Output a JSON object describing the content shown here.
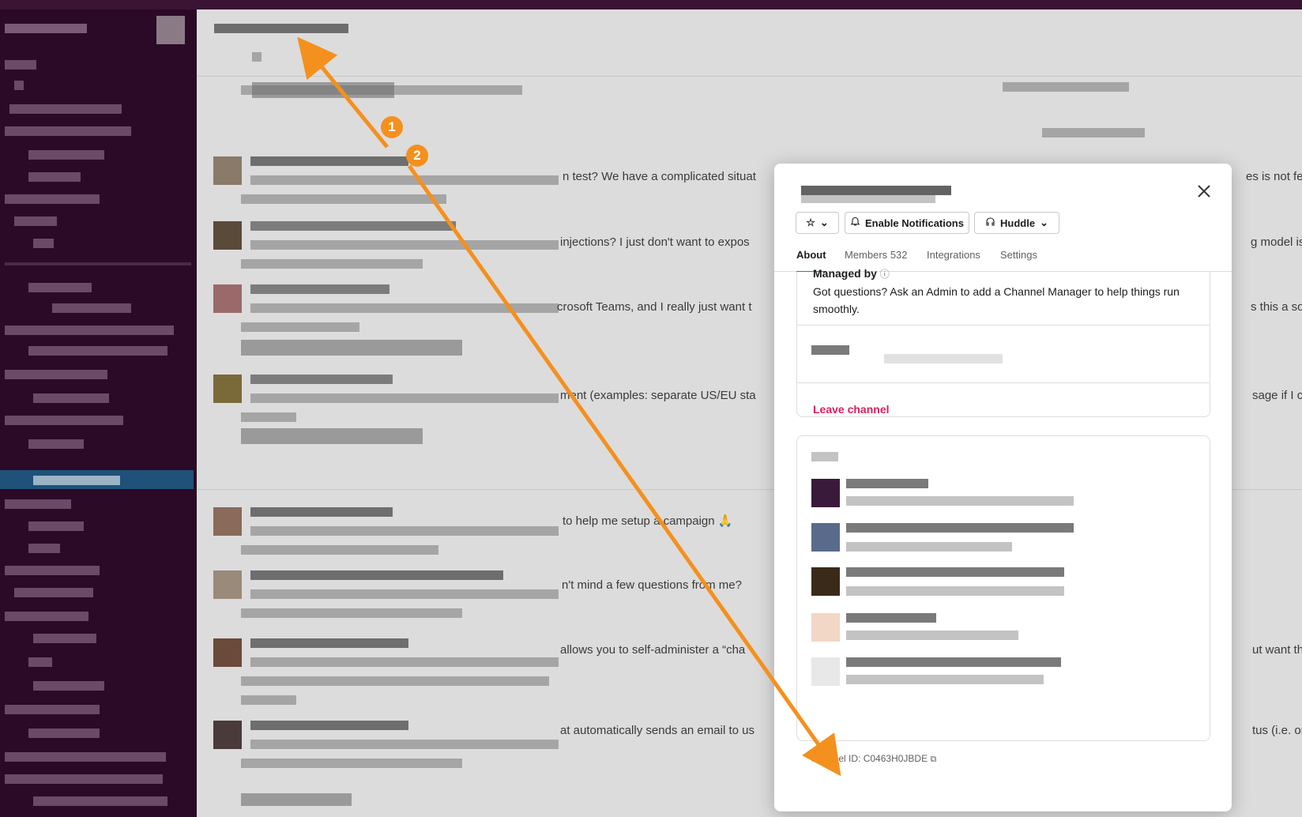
{
  "modal": {
    "enable_notifications_label": "Enable Notifications",
    "huddle_label": "Huddle",
    "tabs": [
      {
        "label": "About"
      },
      {
        "label": "Members",
        "count": "532"
      },
      {
        "label": "Integrations"
      },
      {
        "label": "Settings"
      }
    ],
    "managed_by_title": "Managed by",
    "managed_by_text": "Got questions? Ask an Admin to add a Channel Manager to help things run smoothly.",
    "leave_channel_label": "Leave channel",
    "channel_id_label": "Channel ID: C0463H0JBDE"
  },
  "background_messages": [
    "n test? We have a complicated situat",
    "injections? I just don't want to expos",
    "crosoft Teams, and I really just want t",
    "ment (examples: separate US/EU sta",
    "to help me setup a campaign 🙏",
    "n't mind a few questions from me?",
    "allows you to self-administer a “cha",
    "at automatically sends an email to us"
  ],
  "background_right": [
    "es is not feas",
    "g model is.",
    "s this a solved",
    "sage if I can D",
    "ut want the le",
    "tus (i.e. only s"
  ],
  "badges": [
    "1",
    "2"
  ],
  "colors": {
    "accent_orange": "#f4901e",
    "sidebar_bg": "#2a0a26",
    "leave_red": "#e01e5a",
    "tab_active_underline": "#1d9a5a"
  }
}
